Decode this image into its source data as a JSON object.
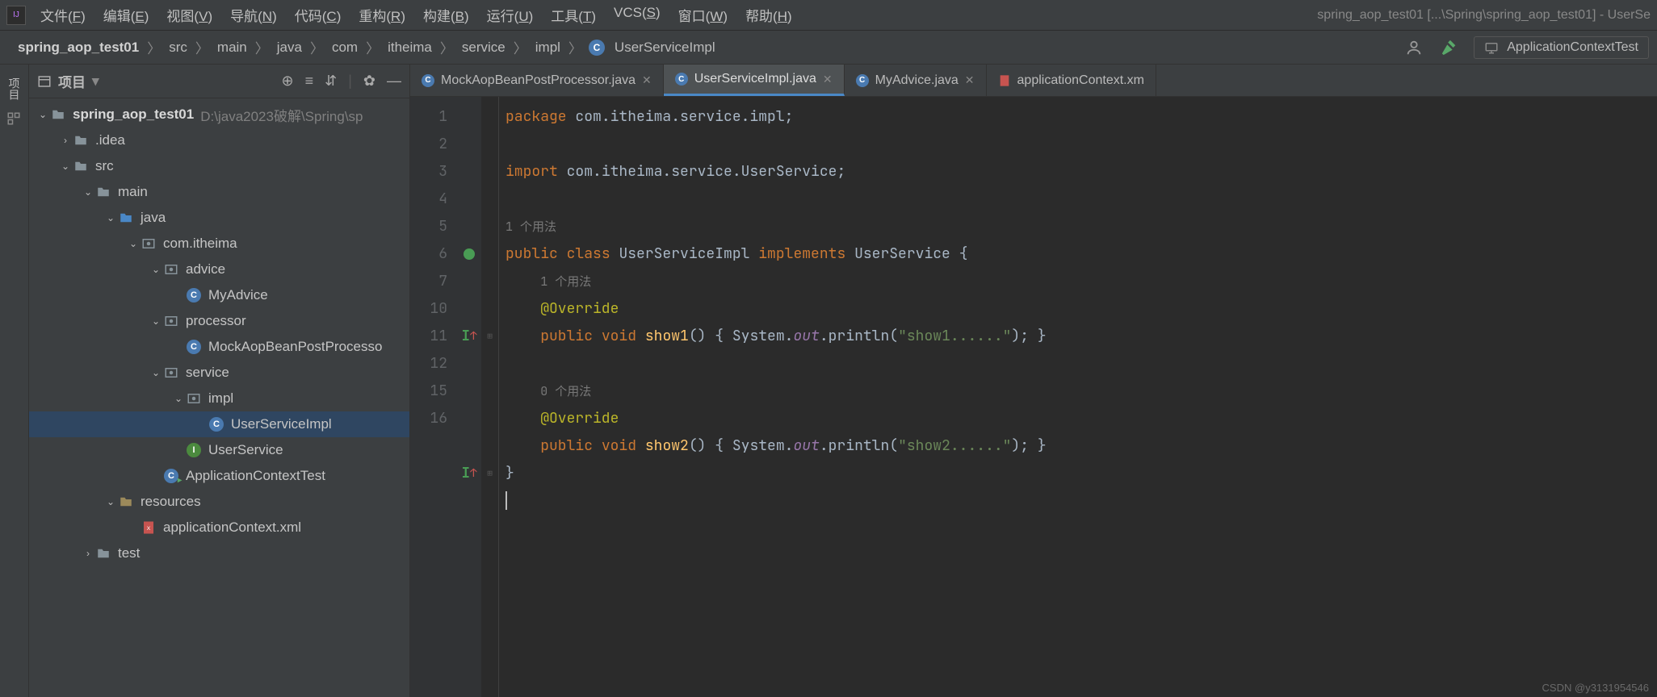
{
  "menu": {
    "items": [
      "文件(F)",
      "编辑(E)",
      "视图(V)",
      "导航(N)",
      "代码(C)",
      "重构(R)",
      "构建(B)",
      "运行(U)",
      "工具(T)",
      "VCS(S)",
      "窗口(W)",
      "帮助(H)"
    ],
    "windowTitle": "spring_aop_test01 [...\\Spring\\spring_aop_test01] - UserSe"
  },
  "breadcrumb": {
    "parts": [
      "spring_aop_test01",
      "src",
      "main",
      "java",
      "com",
      "itheima",
      "service",
      "impl"
    ],
    "current": "UserServiceImpl"
  },
  "runConfig": {
    "name": "ApplicationContextTest"
  },
  "panel": {
    "title": "项目"
  },
  "tree": {
    "root": {
      "name": "spring_aop_test01",
      "path": "D:\\java2023破解\\Spring\\sp"
    },
    "nodes": [
      {
        "depth": 1,
        "arrow": "›",
        "icon": "folder",
        "label": ".idea"
      },
      {
        "depth": 1,
        "arrow": "⌄",
        "icon": "folder",
        "label": "src"
      },
      {
        "depth": 2,
        "arrow": "⌄",
        "icon": "folder",
        "label": "main"
      },
      {
        "depth": 3,
        "arrow": "⌄",
        "icon": "folder-src",
        "label": "java"
      },
      {
        "depth": 4,
        "arrow": "⌄",
        "icon": "package",
        "label": "com.itheima"
      },
      {
        "depth": 5,
        "arrow": "⌄",
        "icon": "package",
        "label": "advice"
      },
      {
        "depth": 6,
        "arrow": "",
        "icon": "class",
        "label": "MyAdvice"
      },
      {
        "depth": 5,
        "arrow": "⌄",
        "icon": "package",
        "label": "processor"
      },
      {
        "depth": 6,
        "arrow": "",
        "icon": "class",
        "label": "MockAopBeanPostProcesso"
      },
      {
        "depth": 5,
        "arrow": "⌄",
        "icon": "package",
        "label": "service"
      },
      {
        "depth": 6,
        "arrow": "⌄",
        "icon": "package",
        "label": "impl"
      },
      {
        "depth": 7,
        "arrow": "",
        "icon": "class",
        "label": "UserServiceImpl",
        "selected": true
      },
      {
        "depth": 6,
        "arrow": "",
        "icon": "interface",
        "label": "UserService"
      },
      {
        "depth": 5,
        "arrow": "",
        "icon": "class-run",
        "label": "ApplicationContextTest"
      },
      {
        "depth": 3,
        "arrow": "⌄",
        "icon": "folder-res",
        "label": "resources"
      },
      {
        "depth": 4,
        "arrow": "",
        "icon": "xml",
        "label": "applicationContext.xml"
      },
      {
        "depth": 2,
        "arrow": "›",
        "icon": "folder",
        "label": "test"
      }
    ]
  },
  "tabs": [
    {
      "icon": "class",
      "name": "MockAopBeanPostProcessor.java",
      "active": false,
      "close": true
    },
    {
      "icon": "class",
      "name": "UserServiceImpl.java",
      "active": true,
      "close": true
    },
    {
      "icon": "class",
      "name": "MyAdvice.java",
      "active": false,
      "close": true
    },
    {
      "icon": "xml",
      "name": "applicationContext.xm",
      "active": false,
      "close": false
    }
  ],
  "editor": {
    "lines": [
      1,
      2,
      3,
      4,
      null,
      5,
      null,
      6,
      7,
      10,
      null,
      null,
      11,
      12,
      15,
      16
    ],
    "usages": {
      "one": "1 个用法",
      "zero": "0 个用法"
    },
    "code": {
      "package": "package",
      "packageName": "com.itheima.service.impl",
      "import": "import",
      "importName": "com.itheima.service.UserService",
      "public": "public",
      "class": "class",
      "className": "UserServiceImpl",
      "implements": "implements",
      "ifaceName": "UserService",
      "override": "@Override",
      "void": "void",
      "show1": "show1",
      "show2": "show2",
      "system": "System",
      "out": "out",
      "println": "println",
      "str1": "\"show1......\"",
      "str2": "\"show2......\""
    }
  },
  "leftTabs": {
    "project": "项目"
  },
  "watermark": "CSDN @y3131954546"
}
